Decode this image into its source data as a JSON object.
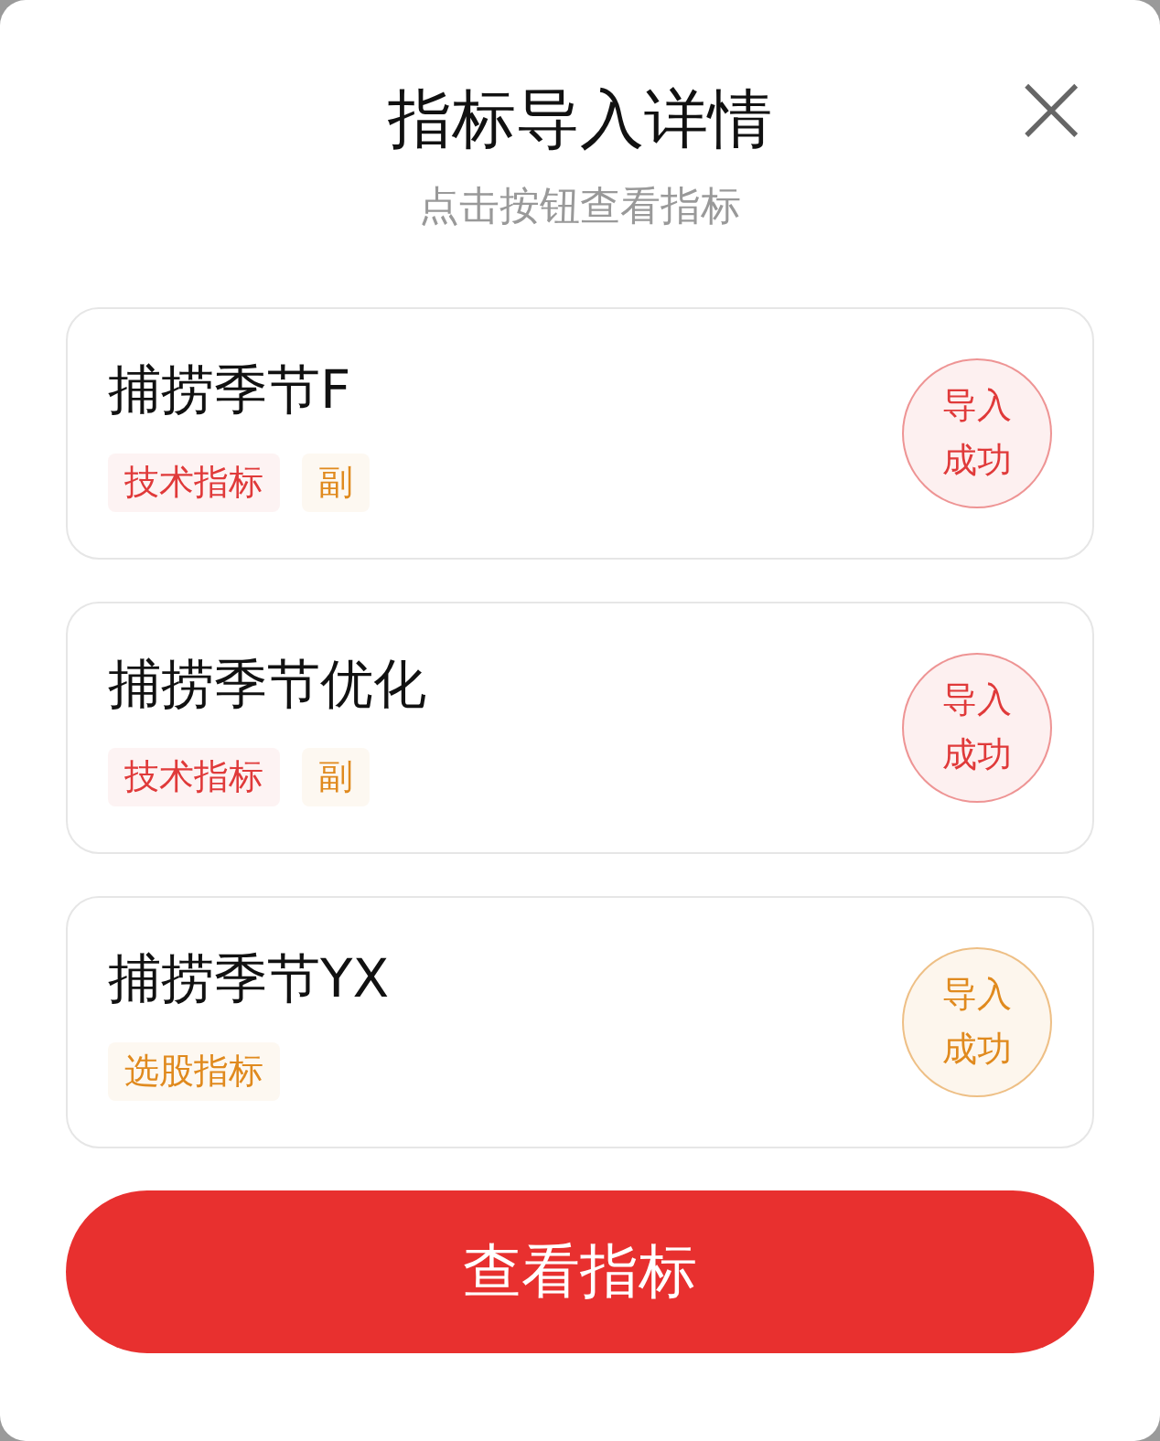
{
  "dialog": {
    "title": "指标导入详情",
    "subtitle": "点击按钮查看指标",
    "close_icon": "×"
  },
  "items": [
    {
      "name": "捕捞季节F",
      "tags": [
        {
          "label": "技术指标",
          "color": "#e03a3a"
        },
        {
          "label": "副",
          "color": "#e08a1e"
        }
      ],
      "status": {
        "line1": "导入",
        "line2": "成功",
        "color": "#e03a3a"
      }
    },
    {
      "name": "捕捞季节优化",
      "tags": [
        {
          "label": "技术指标",
          "color": "#e03a3a"
        },
        {
          "label": "副",
          "color": "#e08a1e"
        }
      ],
      "status": {
        "line1": "导入",
        "line2": "成功",
        "color": "#e03a3a"
      }
    },
    {
      "name": "捕捞季节YX",
      "tags": [
        {
          "label": "选股指标",
          "color": "#e08a1e"
        }
      ],
      "status": {
        "line1": "导入",
        "line2": "成功",
        "color": "#e08a1e"
      }
    }
  ],
  "primary_button": "查看指标"
}
